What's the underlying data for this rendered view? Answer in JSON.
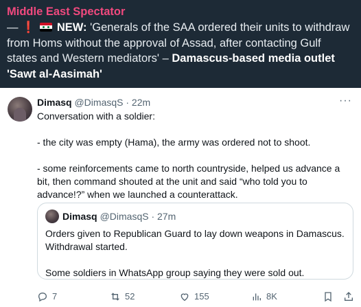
{
  "caption": {
    "source": "Middle East Spectator",
    "dash": "—",
    "new_label": "NEW:",
    "headline": " 'Generals of the SAA ordered their units to withdraw from Homs without the approval of Assad, after contacting Gulf states and Western mediators' – ",
    "attribution": "Damascus-based media outlet 'Sawt al-Aasimah'"
  },
  "tweet": {
    "author_name": "Dimasq",
    "author_meta": "@DimasqS · 22m",
    "more": "···",
    "paragraphs": [
      "Conversation with a soldier:",
      "- the city was empty (Hama), the army was ordered not to shoot.",
      "- some reinforcements came to north countryside, helped us advance a bit, then command shouted at the unit and said “who told you to advance!?” when we launched a counterattack."
    ],
    "quote": {
      "author_name": "Dimasq",
      "author_meta": "@DimasqS · 27m",
      "paragraphs": [
        "Orders given to Republican Guard to lay down weapons in Damascus. Withdrawal started.",
        "Some soldiers in WhatsApp group saying they were sold out."
      ]
    },
    "actions": {
      "replies": "7",
      "reposts": "52",
      "likes": "155",
      "views": "8K"
    }
  },
  "icons": {
    "reply": "reply-icon",
    "repost": "repost-icon",
    "like": "heart-icon",
    "views": "views-icon",
    "bookmark": "bookmark-icon",
    "share": "share-icon",
    "flag": "syria-flag-icon",
    "alert": "exclamation-icon"
  },
  "colors": {
    "caption_bg": "#1d2a36",
    "source_name": "#f0497e",
    "secondary_text": "#536471",
    "border": "#cfd9de"
  }
}
